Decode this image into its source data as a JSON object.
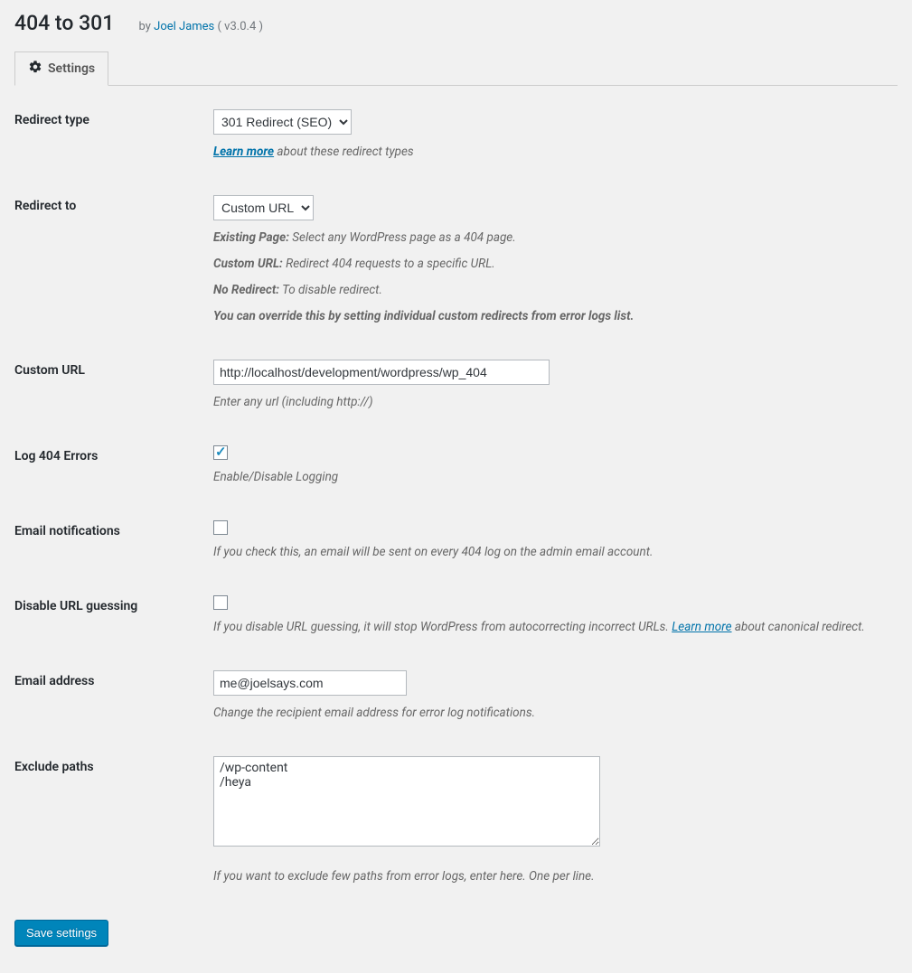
{
  "header": {
    "title": "404 to 301",
    "by_prefix": "by ",
    "author": "Joel James",
    "version": " ( v3.0.4 )"
  },
  "tabs": {
    "settings": "Settings"
  },
  "form": {
    "redirect_type": {
      "label": "Redirect type",
      "selected": "301 Redirect (SEO)",
      "learn_more": "Learn more",
      "help_suffix": " about these redirect types"
    },
    "redirect_to": {
      "label": "Redirect to",
      "selected": "Custom URL",
      "existing_page": {
        "k": "Existing Page:",
        "v": " Select any WordPress page as a 404 page."
      },
      "custom_url": {
        "k": "Custom URL:",
        "v": " Redirect 404 requests to a specific URL."
      },
      "no_redirect": {
        "k": "No Redirect:",
        "v": " To disable redirect."
      },
      "override_note": "You can override this by setting individual custom redirects from error logs list."
    },
    "custom_url": {
      "label": "Custom URL",
      "value": "http://localhost/development/wordpress/wp_404",
      "help": "Enter any url (including http://)"
    },
    "log_errors": {
      "label": "Log 404 Errors",
      "checked": true,
      "help": "Enable/Disable Logging"
    },
    "email_notifications": {
      "label": "Email notifications",
      "checked": false,
      "help": "If you check this, an email will be sent on every 404 log on the admin email account."
    },
    "disable_url_guessing": {
      "label": "Disable URL guessing",
      "checked": false,
      "help_prefix": "If you disable URL guessing, it will stop WordPress from autocorrecting incorrect URLs. ",
      "learn_more": "Learn more",
      "help_suffix": " about canonical redirect."
    },
    "email_address": {
      "label": "Email address",
      "value": "me@joelsays.com",
      "help": "Change the recipient email address for error log notifications."
    },
    "exclude_paths": {
      "label": "Exclude paths",
      "value": "/wp-content\n/heya",
      "help": "If you want to exclude few paths from error logs, enter here. One per line."
    }
  },
  "save_button": "Save settings"
}
